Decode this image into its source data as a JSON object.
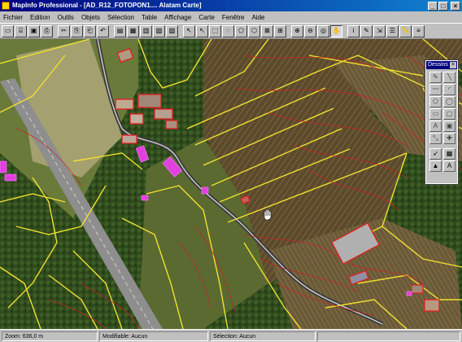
{
  "window": {
    "title": "MapInfo Professional - [AD_R12_FOTOPON1.... Alatam Carte]",
    "minimize_glyph": "_",
    "maximize_glyph": "□",
    "close_glyph": "×"
  },
  "menu": [
    "Fichier",
    "Edition",
    "Outils",
    "Objets",
    "Sélection",
    "Table",
    "Affichage",
    "Carte",
    "Fenêtre",
    "Aide"
  ],
  "toolbar": {
    "buttons": [
      {
        "name": "new-icon",
        "glyph": "▭"
      },
      {
        "name": "open-icon",
        "glyph": "⌸"
      },
      {
        "name": "save-icon",
        "glyph": "▣"
      },
      {
        "name": "print-icon",
        "glyph": "⎙"
      },
      {
        "name": "cut-icon",
        "glyph": "✂"
      },
      {
        "name": "copy-icon",
        "glyph": "⎘"
      },
      {
        "name": "paste-icon",
        "glyph": "⎗"
      },
      {
        "name": "undo-icon",
        "glyph": "↶"
      },
      {
        "name": "layer-browse-icon",
        "glyph": "▤"
      },
      {
        "name": "map-window-icon",
        "glyph": "▦"
      },
      {
        "name": "graph-window-icon",
        "glyph": "▥"
      },
      {
        "name": "layout-window-icon",
        "glyph": "▧"
      },
      {
        "name": "redistrict-icon",
        "glyph": "▨"
      },
      {
        "name": "help-pointer-icon",
        "glyph": "↖"
      },
      {
        "name": "select-arrow-icon",
        "glyph": "↖"
      },
      {
        "name": "marquee-select-icon",
        "glyph": "⬚"
      },
      {
        "name": "radius-select-icon",
        "glyph": "◌"
      },
      {
        "name": "polygon-select-icon",
        "glyph": "⬠"
      },
      {
        "name": "boundary-select-icon",
        "glyph": "⬡"
      },
      {
        "name": "unselect-all-icon",
        "glyph": "⊠"
      },
      {
        "name": "graph-select-icon",
        "glyph": "⊞"
      },
      {
        "name": "zoom-in-icon",
        "glyph": "⊕"
      },
      {
        "name": "zoom-out-icon",
        "glyph": "⊖"
      },
      {
        "name": "change-view-icon",
        "glyph": "◎"
      },
      {
        "name": "grabber-icon",
        "glyph": "✋"
      },
      {
        "name": "info-icon",
        "glyph": "i"
      },
      {
        "name": "label-icon",
        "glyph": "✎"
      },
      {
        "name": "drag-window-icon",
        "glyph": "⇲"
      },
      {
        "name": "layer-control-icon",
        "glyph": "☰"
      },
      {
        "name": "ruler-icon",
        "glyph": "📏"
      },
      {
        "name": "legend-icon",
        "glyph": "≡"
      }
    ]
  },
  "palette": {
    "title": "Dessins",
    "close_glyph": "×",
    "buttons": [
      {
        "name": "symbol-tool-icon",
        "glyph": "✎"
      },
      {
        "name": "line-tool-icon",
        "glyph": "╲"
      },
      {
        "name": "polyline-tool-icon",
        "glyph": "〰"
      },
      {
        "name": "arc-tool-icon",
        "glyph": "◜"
      },
      {
        "name": "polygon-tool-icon",
        "glyph": "⬠"
      },
      {
        "name": "ellipse-tool-icon",
        "glyph": "◯"
      },
      {
        "name": "rectangle-tool-icon",
        "glyph": "▭"
      },
      {
        "name": "rounded-rect-tool-icon",
        "glyph": "▢"
      },
      {
        "name": "text-tool-icon",
        "glyph": "A"
      },
      {
        "name": "frame-tool-icon",
        "glyph": "▣"
      },
      {
        "name": "reshape-tool-icon",
        "glyph": "⤡"
      },
      {
        "name": "add-node-tool-icon",
        "glyph": "✚"
      },
      {
        "name": "line-style-icon",
        "glyph": "➶"
      },
      {
        "name": "region-style-icon",
        "glyph": "▦"
      },
      {
        "name": "symbol-style-icon",
        "glyph": "▲"
      },
      {
        "name": "text-style-icon",
        "glyph": "A"
      }
    ]
  },
  "status": {
    "zoom": "Zoom: 636,0 m",
    "editable": "Modifiable: Aucun",
    "selectable": "Sélection: Aucun"
  },
  "colors": {
    "parcel_boundary": "#f0e030",
    "contour_line": "#d02020",
    "building_fill": "#e040e0",
    "road": "#a0a0a0",
    "title_gradient_start": "#000080",
    "title_gradient_end": "#1084d0"
  }
}
